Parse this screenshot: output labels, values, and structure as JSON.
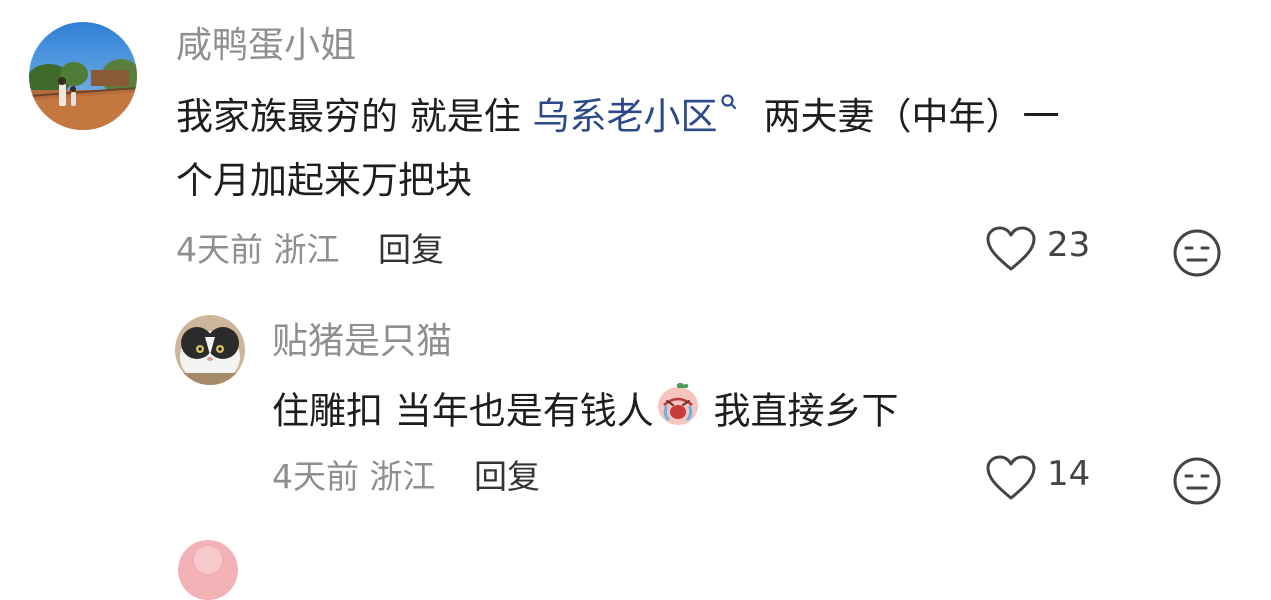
{
  "comments": [
    {
      "username": "咸鸭蛋小姐",
      "text_before_link": "我家族最穷的 就是住 ",
      "link_text": "乌系老小区",
      "text_after_link": "两夫妻（中年）一",
      "text_line2": "个月加起来万把块",
      "time": "4天前",
      "location": "浙江",
      "reply_label": "回复",
      "likes": "23"
    },
    {
      "username": "贴猪是只猫",
      "text_before_emoji": "住雕扣 当年也是有钱人",
      "text_after_emoji": " 我直接乡下",
      "time": "4天前",
      "location": "浙江",
      "reply_label": "回复",
      "likes": "14"
    }
  ],
  "icons": {
    "search": "search-icon",
    "like": "heart-outline-icon",
    "dislike": "neutral-face-icon",
    "emoji": "crying-peach-emoji"
  },
  "colors": {
    "link": "#2c4a8a",
    "muted": "#8f8f8f",
    "text": "#1e1e1e"
  }
}
